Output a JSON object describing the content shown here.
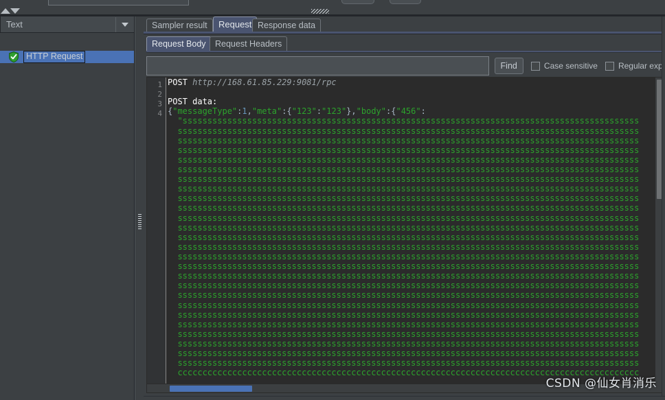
{
  "window": {
    "theme_bg": "#3c4043",
    "accent": "#4a72b5",
    "editor_bg": "#2b2b2b"
  },
  "top_toolbar": {
    "scroll_up_icon": "triangle-up-icon",
    "scroll_down_icon": "triangle-down-icon",
    "drag_handle_icon": "hatched-grip-icon",
    "button_1_label": "",
    "button_2_label": "",
    "textfield_value": ""
  },
  "sidebar": {
    "filter_combo": {
      "value": "Text",
      "arrow_icon": "chevron-down-icon"
    },
    "tree": {
      "items": [
        {
          "label": "HTTP Request",
          "status_icon": "green-shield-check-icon",
          "selected": true
        }
      ]
    },
    "splitter_grip_icon": "dotted-grip-icon"
  },
  "main": {
    "outer_tabs": [
      {
        "label": "Sampler result",
        "active": false
      },
      {
        "label": "Request",
        "active": true
      },
      {
        "label": "Response data",
        "active": false
      }
    ],
    "inner_tabs": [
      {
        "label": "Request Body",
        "active": true
      },
      {
        "label": "Request Headers",
        "active": false
      }
    ],
    "find_bar": {
      "search_value": "",
      "search_placeholder": "",
      "find_label": "Find",
      "case_sensitive_label": "Case sensitive",
      "case_sensitive_checked": false,
      "regular_exp_label": "Regular exp.",
      "regular_exp_checked": false
    },
    "editor": {
      "line_numbers": [
        "1",
        "2",
        "3",
        "4"
      ],
      "lines": [
        {
          "tokens": [
            {
              "text": "POST ",
              "cls": "kw"
            },
            {
              "text": "http://168.61.85.229:9081/rpc",
              "cls": "url"
            }
          ]
        },
        {
          "tokens": []
        },
        {
          "tokens": [
            {
              "text": "POST data:",
              "cls": "kw"
            }
          ]
        },
        {
          "tokens": [
            {
              "text": "{",
              "cls": "punc"
            },
            {
              "text": "\"messageType\"",
              "cls": "str"
            },
            {
              "text": ":",
              "cls": "punc"
            },
            {
              "text": "1",
              "cls": "num"
            },
            {
              "text": ",",
              "cls": "punc"
            },
            {
              "text": "\"meta\"",
              "cls": "str"
            },
            {
              "text": ":",
              "cls": "punc"
            },
            {
              "text": "{",
              "cls": "punc"
            },
            {
              "text": "\"123\"",
              "cls": "str"
            },
            {
              "text": ":",
              "cls": "punc"
            },
            {
              "text": "\"123\"",
              "cls": "str"
            },
            {
              "text": "}",
              "cls": "punc"
            },
            {
              "text": ",",
              "cls": "punc"
            },
            {
              "text": "\"body\"",
              "cls": "str"
            },
            {
              "text": ":",
              "cls": "punc"
            },
            {
              "text": "{",
              "cls": "punc"
            },
            {
              "text": "\"456\"",
              "cls": "str"
            },
            {
              "text": ":",
              "cls": "punc"
            }
          ]
        }
      ],
      "wrapped_filler": {
        "char": "s",
        "first_line_prefix": "\"",
        "chars_per_line": 95,
        "line_count": 27,
        "last_line_char": "c",
        "color": "#2ca32c"
      },
      "vertical_scrollbar": {
        "thumb_position": "top"
      },
      "horizontal_scrollbar": {
        "thumb_position": "left"
      }
    }
  },
  "watermark": {
    "text": "CSDN @仙女肖消乐"
  }
}
